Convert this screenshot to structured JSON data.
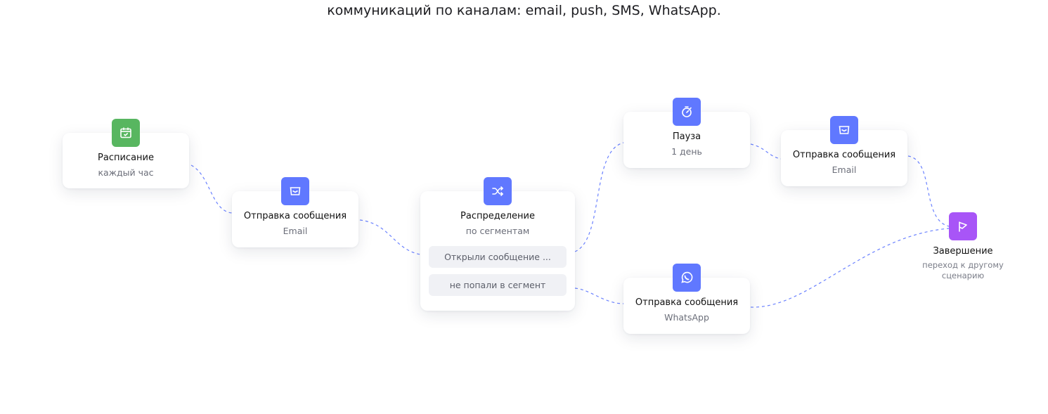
{
  "caption": "коммуникаций по каналам: email, push, SMS, WhatsApp.",
  "nodes": {
    "schedule": {
      "title": "Расписание",
      "subtitle": "каждый час",
      "icon": "calendar-icon"
    },
    "send_email_1": {
      "title": "Отправка сообщения",
      "subtitle": "Email",
      "icon": "envelope-icon"
    },
    "distribution": {
      "title": "Распределение",
      "subtitle": "по сегментам",
      "icon": "shuffle-icon",
      "branches": [
        "Открыли сообщение ...",
        "не попали в сегмент"
      ]
    },
    "pause": {
      "title": "Пауза",
      "subtitle": "1 день",
      "icon": "stopwatch-icon"
    },
    "send_email_2": {
      "title": "Отправка сообщения",
      "subtitle": "Email",
      "icon": "envelope-icon"
    },
    "send_whatsapp": {
      "title": "Отправка сообщения",
      "subtitle": "WhatsApp",
      "icon": "whatsapp-icon"
    },
    "finish": {
      "title": "Завершение",
      "subtitle": "переход к другому сценарию",
      "icon": "flag-icon"
    }
  },
  "colors": {
    "green": "#58b660",
    "blue": "#6078ff",
    "purple": "#a855f7",
    "connector": "#6b82ff"
  }
}
